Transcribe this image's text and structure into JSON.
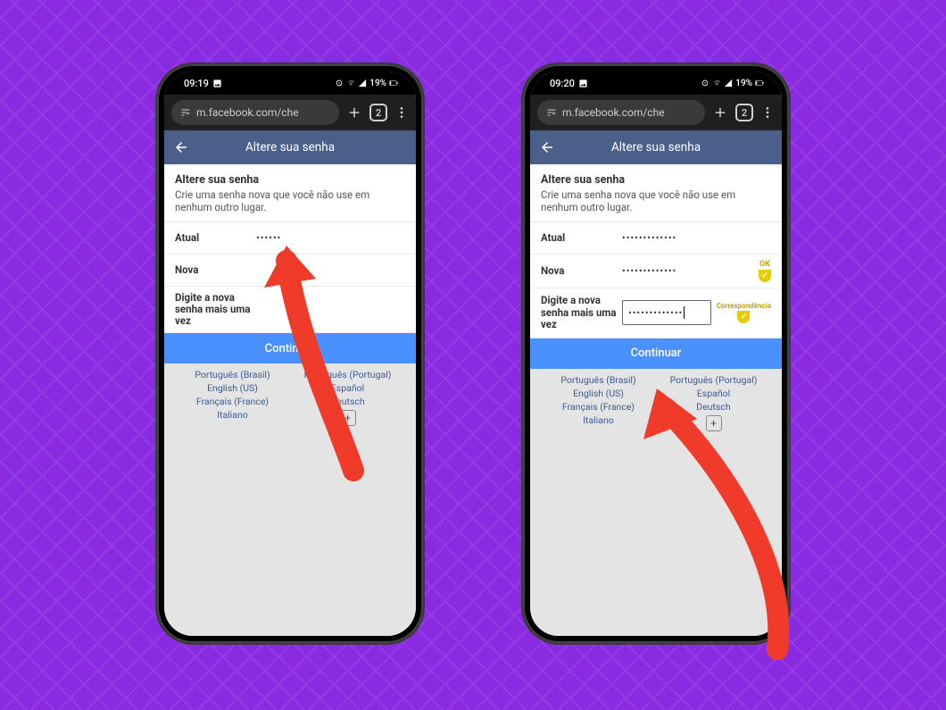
{
  "phone1": {
    "statusbar": {
      "time": "09:19",
      "battery_text": "19%"
    },
    "browser": {
      "url": "m.facebook.com/che",
      "tab_count": "2"
    },
    "header": {
      "title": "Altere sua senha"
    },
    "intro": {
      "title": "Altere sua senha",
      "subtitle": "Crie uma senha nova que você não use em nenhum outro lugar."
    },
    "fields": {
      "current_label": "Atual",
      "current_value": "••••••",
      "new_label": "Nova",
      "new_value": "",
      "retype_label": "Digite a nova senha mais uma vez",
      "retype_value": ""
    },
    "continue_label": "Continuar",
    "languages": {
      "left": [
        "Português (Brasil)",
        "English (US)",
        "Français (France)",
        "Italiano"
      ],
      "right": [
        "Português (Portugal)",
        "Español",
        "Deutsch"
      ]
    }
  },
  "phone2": {
    "statusbar": {
      "time": "09:20",
      "battery_text": "19%"
    },
    "browser": {
      "url": "m.facebook.com/che",
      "tab_count": "2"
    },
    "header": {
      "title": "Altere sua senha"
    },
    "intro": {
      "title": "Altere sua senha",
      "subtitle": "Crie uma senha nova que você não use em nenhum outro lugar."
    },
    "fields": {
      "current_label": "Atual",
      "current_value": "•••••••••••••",
      "new_label": "Nova",
      "new_value": "•••••••••••••",
      "new_badge": "OK",
      "retype_label": "Digite a nova senha mais uma vez",
      "retype_value": "•••••••••••••",
      "retype_badge": "Correspondência"
    },
    "continue_label": "Continuar",
    "languages": {
      "left": [
        "Português (Brasil)",
        "English (US)",
        "Français (France)",
        "Italiano"
      ],
      "right": [
        "Português (Portugal)",
        "Español",
        "Deutsch"
      ]
    }
  }
}
